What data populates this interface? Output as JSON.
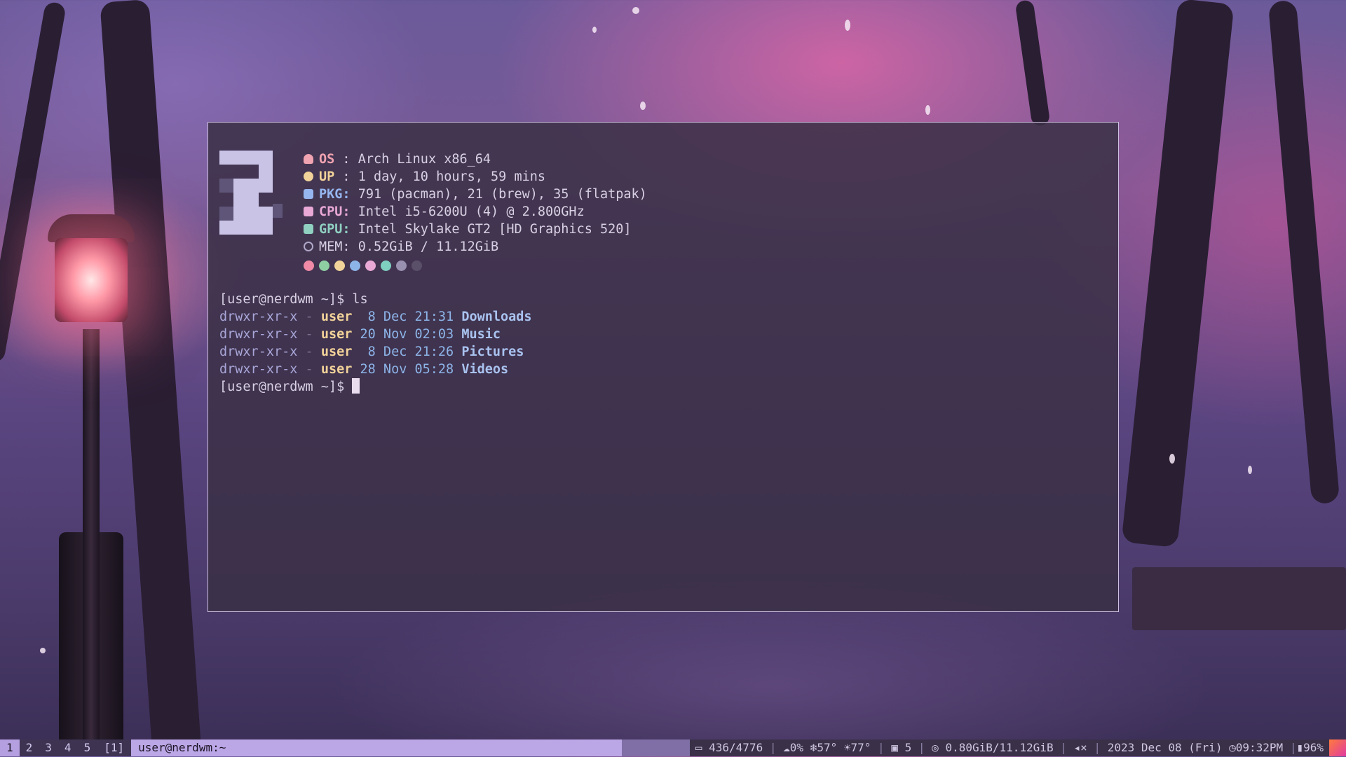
{
  "terminal": {
    "fetch": [
      {
        "key": "OS",
        "value": "Arch Linux x86_64",
        "icon": "arch-icon",
        "color": "#f0a3b0"
      },
      {
        "key": "UP",
        "value": "1 day, 10 hours, 59 mins",
        "icon": "clock-icon",
        "color": "#f2d399"
      },
      {
        "key": "PKG:",
        "value": "791 (pacman), 21 (brew), 35 (flatpak)",
        "icon": "package-icon",
        "color": "#96b6f0"
      },
      {
        "key": "CPU:",
        "value": "Intel i5-6200U (4) @ 2.800GHz",
        "icon": "cpu-icon",
        "color": "#e9a8d6"
      },
      {
        "key": "GPU:",
        "value": "Intel Skylake GT2 [HD Graphics 520]",
        "icon": "gpu-icon",
        "color": "#8fd0c0"
      },
      {
        "key": "MEM:",
        "value": "0.52GiB / 11.12GiB",
        "icon": "memory-icon",
        "color": "#b0a8c8"
      }
    ],
    "swatch_colors": [
      "#f08aa6",
      "#8fd0a3",
      "#f2d399",
      "#8db4e8",
      "#e9a8d6",
      "#7fcfc0",
      "#9a90b0",
      "#5a506a"
    ],
    "prompt1": "[user@nerdwm ~]$ ",
    "command": "ls",
    "ls": [
      {
        "perm": "drwxr-xr-x",
        "sep": "-",
        "owner": "user",
        "date": " 8 Dec 21:31",
        "name": "Downloads"
      },
      {
        "perm": "drwxr-xr-x",
        "sep": "-",
        "owner": "user",
        "date": "20 Nov 02:03",
        "name": "Music"
      },
      {
        "perm": "drwxr-xr-x",
        "sep": "-",
        "owner": "user",
        "date": " 8 Dec 21:26",
        "name": "Pictures"
      },
      {
        "perm": "drwxr-xr-x",
        "sep": "-",
        "owner": "user",
        "date": "28 Nov 05:28",
        "name": "Videos"
      }
    ],
    "prompt2": "[user@nerdwm ~]$ "
  },
  "bar": {
    "workspaces": [
      "1",
      "2",
      "3",
      "4",
      "5"
    ],
    "active_workspace": "1",
    "layout": "[1]",
    "window_title": "user@nerdwm:~",
    "disk": "436/4776",
    "rain": "0%",
    "temp_low": "57°",
    "temp_high": "77°",
    "updates": "5",
    "memory": "0.80GiB/11.12GiB",
    "date": "2023 Dec 08 (Fri)",
    "time": "09:32PM",
    "battery": "96%"
  }
}
